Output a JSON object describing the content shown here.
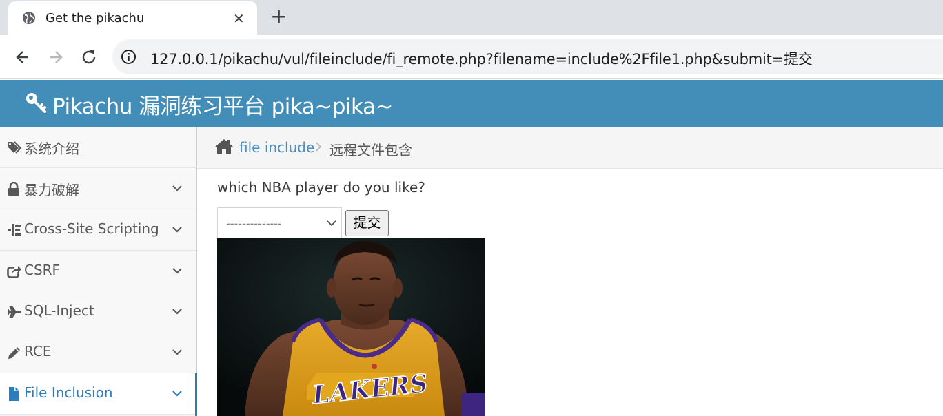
{
  "browser": {
    "tab_title": "Get the pikachu",
    "close_glyph": "✕",
    "newtab_glyph": "+",
    "url": "127.0.0.1/pikachu/vul/fileinclude/fi_remote.php?filename=include%2Ffile1.php&submit=提交"
  },
  "header": {
    "brand": "Pikachu 漏洞练习平台 pika~pika~"
  },
  "sidebar": {
    "items": [
      {
        "label": "系统介绍",
        "icon": "tags-icon",
        "has_chevron": false
      },
      {
        "label": "暴力破解",
        "icon": "lock-icon",
        "has_chevron": true
      },
      {
        "label": "Cross-Site Scripting",
        "icon": "list-icon",
        "has_chevron": true
      },
      {
        "label": "CSRF",
        "icon": "share-icon",
        "has_chevron": true
      },
      {
        "label": "SQL-Inject",
        "icon": "plane-icon",
        "has_chevron": true
      },
      {
        "label": "RCE",
        "icon": "pencil-icon",
        "has_chevron": true
      },
      {
        "label": "File Inclusion",
        "icon": "file-icon",
        "has_chevron": true,
        "active": true
      }
    ]
  },
  "breadcrumb": {
    "section": "file include",
    "current": "远程文件包含"
  },
  "form": {
    "question": "which NBA player do you like?",
    "select_value": "--------------",
    "submit_label": "提交"
  },
  "colors": {
    "header_bg": "#438eb9",
    "active_link": "#2b7dbc",
    "breadcrumb_link": "#4c8fbd"
  }
}
